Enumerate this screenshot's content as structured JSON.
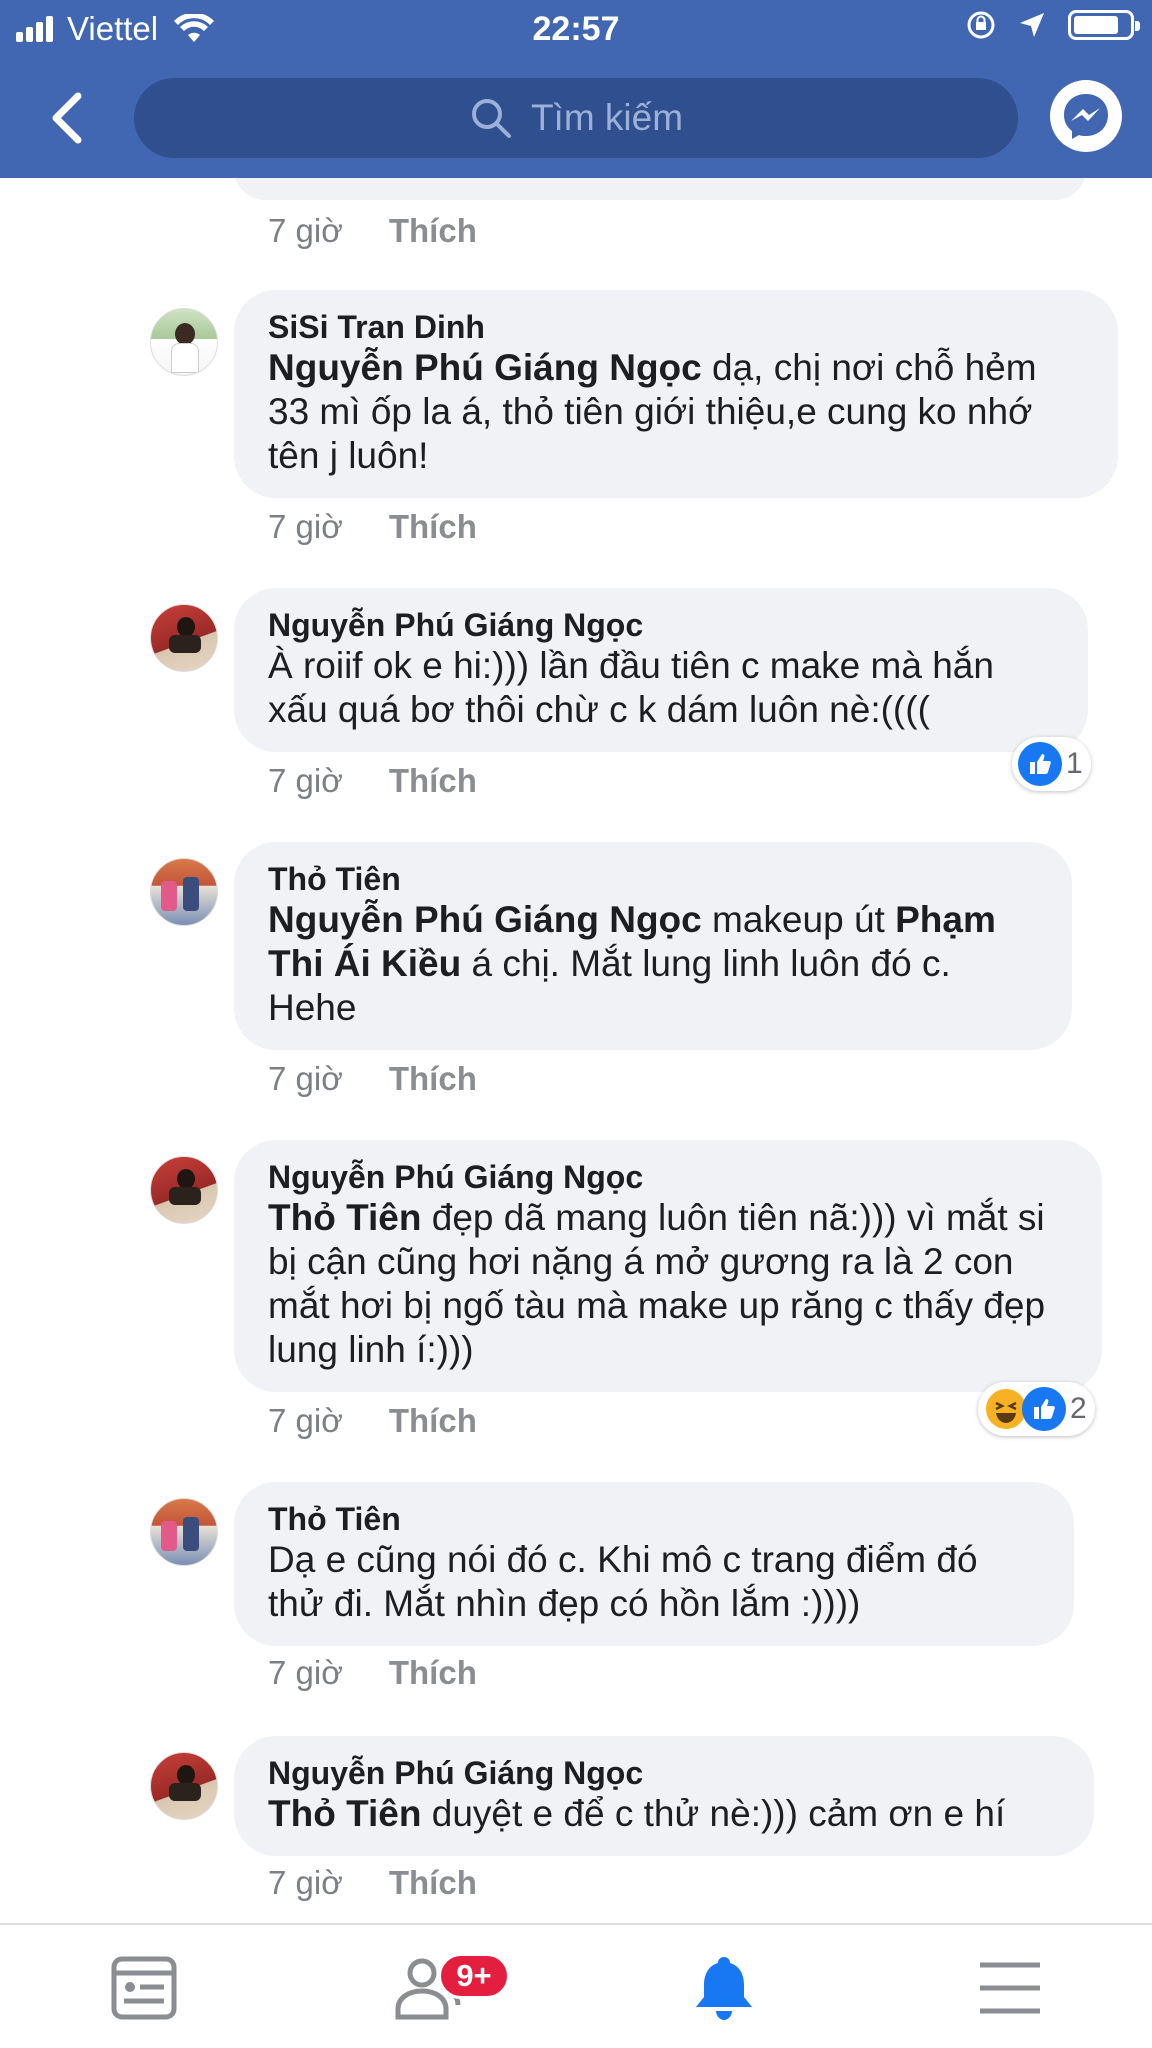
{
  "status_bar": {
    "carrier": "Viettel",
    "time": "22:57"
  },
  "search": {
    "placeholder": "Tìm kiếm"
  },
  "comments": [
    {
      "meta_time": "7 giờ",
      "like_label": "Thích"
    },
    {
      "author": "SiSi Tran Dinh",
      "mention": "Nguyễn Phú Giáng Ngọc",
      "text": " dạ, chị nơi chỗ hẻm 33 mì ốp la á, thỏ tiên giới thiệu,e cung ko nhớ tên j luôn!",
      "time": "7 giờ",
      "like_label": "Thích"
    },
    {
      "author": "Nguyễn Phú Giáng Ngọc",
      "text": "À roiif ok e hi:))) lần đầu tiên c make mà hắn xấu quá bơ thôi chừ c k dám luôn nè:((((",
      "time": "7 giờ",
      "like_label": "Thích",
      "reaction_count": "1"
    },
    {
      "author": "Thỏ Tiên",
      "mention": "Nguyễn Phú Giáng Ngọc",
      "text_a": " makeup út ",
      "mention2": "Phạm Thi Ái Kiều",
      "text_b": " á chị. Mắt lung linh luôn đó c. Hehe",
      "time": "7 giờ",
      "like_label": "Thích"
    },
    {
      "author": "Nguyễn Phú Giáng Ngọc",
      "mention": "Thỏ Tiên",
      "text": " đẹp dã mang luôn tiên nã:))) vì mắt si bị cận cũng hơi nặng á mở gương ra là 2 con mắt hơi bị ngố tàu mà make up răng c thấy đẹp lung linh í:)))",
      "time": "7 giờ",
      "like_label": "Thích",
      "reaction_count": "2"
    },
    {
      "author": "Thỏ Tiên",
      "text": "Dạ e cũng nói đó c. Khi mô c trang điểm đó thử đi. Mắt nhìn đẹp có hồn lắm :))))",
      "time": "7 giờ",
      "like_label": "Thích"
    },
    {
      "author": "Nguyễn Phú Giáng Ngọc",
      "mention": "Thỏ Tiên",
      "text": " duyệt e để c thử nè:))) cảm ơn e hí",
      "time": "7 giờ",
      "like_label": "Thích"
    }
  ],
  "tab_bar": {
    "friends_badge": "9+"
  },
  "colors": {
    "header_blue": "#4267b2",
    "bubble_gray": "#f0f2f5",
    "active_tab": "#1877f2",
    "badge_red": "#e41e3f"
  }
}
